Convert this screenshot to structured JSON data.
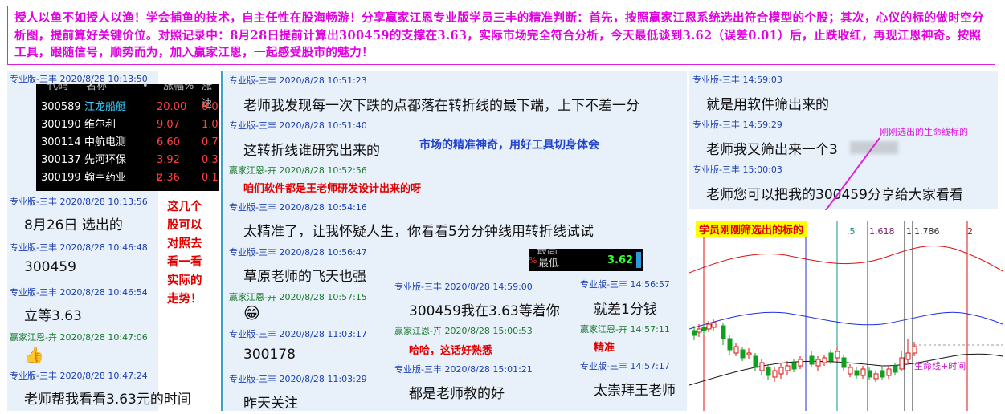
{
  "banner": {
    "text": "授人以鱼不如授人以渔！学会捕鱼的技术，自主任性在股海畅游！分享赢家江恩专业版学员三丰的精准判断：首先，按照赢家江恩系统选出符合模型的个股；其次，心仪的标的做时空分析图，提前算好关键价位。对照记录中：8月28日提前计算出300459的支撑在3.63，实际市场完全符合分析，今天最低谈到3.62（误差0.01）后，止跌收红，再现江恩神奇。按照工具，跟随信号，顺势而为，加入赢家江恩，一起感受股市的魅力！"
  },
  "stock_table": {
    "headers": [
      "代码",
      "名称",
      "•",
      "涨幅%",
      "涨速"
    ],
    "rows": [
      {
        "code": "300589",
        "name": "江龙船艇",
        "change": "20.00",
        "speed": "0.0",
        "name_color": "#3ad0ff"
      },
      {
        "code": "300190",
        "name": "维尔利",
        "change": "9.07",
        "speed": "1.0",
        "name_color": "#ffffff"
      },
      {
        "code": "300114",
        "name": "中航电测",
        "change": "6.60",
        "speed": "0.7",
        "name_color": "#ffffff"
      },
      {
        "code": "300137",
        "name": "先河环保",
        "change": "3.92",
        "speed": "0.3",
        "name_color": "#ffffff"
      },
      {
        "code": "300199",
        "name": "翰宇药业",
        "change": "2.36",
        "speed": "0.1",
        "name_color": "#ffffff",
        "flag": "R"
      }
    ]
  },
  "col1": {
    "h1": "专业版-三丰 2020/8/28 10:13:50",
    "h2": "专业版-三丰 2020/8/28 10:13:56",
    "m2": "8月26日 选出的",
    "h3": "专业版-三丰 2020/8/28 10:46:48",
    "m3": "300459",
    "h4": "专业版-三丰 2020/8/28 10:46:54",
    "m4": "立等3.63",
    "h5": "赢家江恩-卉 2020/8/28 10:47:06",
    "m5": "👍",
    "h6": "专业版-三丰 2020/8/28 10:47:24",
    "m6": "老师帮我看看3.63元的时间"
  },
  "note_left": [
    "这几个",
    "股可以",
    "对照去",
    "看一看",
    "实际的",
    "走势！"
  ],
  "col2": {
    "h1": "专业版-三丰 2020/8/28 10:51:23",
    "m1": "老师我发现每一次下跌的点都落在转折线的最下端，上下不差一分",
    "h2": "专业版-三丰 2020/8/28 10:51:40",
    "m2": "这转折线谁研究出来的",
    "note_blue": "市场的精准神奇，用好工具切身体会",
    "h3": "赢家江恩-卉 2020/8/28 10:52:56",
    "m3": "咱们软件都是王老师研发设计出来的呀",
    "h4": "专业版-三丰 2020/8/28 10:54:16",
    "m4": "太精准了，让我怀疑人生，你看看5分分钟线用转折线试试",
    "h5": "专业版-三丰 2020/8/28 10:56:47",
    "m5": "草原老师的飞天也强",
    "h6": "赢家江恩-卉 2020/8/28 10:57:15",
    "m6": "😁",
    "h7": "专业版-三丰 2020/8/28 11:03:17",
    "m7": "300178",
    "h8": "专业版-三丰 2020/8/28 11:03:29",
    "m8": "昨天关注"
  },
  "mini_quote": {
    "label": "最低",
    "value": "3.62",
    "prev": "最高"
  },
  "col3": {
    "h1": "专业版-三丰 2020/8/28 14:59:00",
    "m1": "300459我在3.63等着你",
    "h2": "赢家江恩-卉 2020/8/28 15:00:53",
    "m2": "哈哈，这话好熟悉",
    "h3": "专业版-三丰 2020/8/28 15:01:21",
    "m3": "都是老师教的好"
  },
  "col4": {
    "h1": "专业版-三丰 14:56:57",
    "m1": "就差1分钱",
    "h2": "赢家江恩-卉 14:57:11",
    "m2": "精准",
    "h3": "专业版-三丰 14:57:17",
    "m3": "太崇拜王老师"
  },
  "col5": {
    "h1": "专业版-三丰 14:59:03",
    "m1": "就是用软件筛出来的",
    "h2": "专业版-三丰 14:59:29",
    "m2": "老师我又筛出来一个3",
    "h3": "专业版-三丰 15:00:03",
    "m3": "老师您可以把我的300459分享给大家看看",
    "annotation": "刚刚选出的生命线标的"
  },
  "chart_data": {
    "type": "line",
    "title_badge": "学员刚刚筛选出的标的",
    "fib_labels": [
      ".5",
      "1.618",
      "1",
      "1.786",
      "2"
    ],
    "legend": "生命线+时间",
    "colors": {
      "upper": "#e01010",
      "middle": "#1e2ee0",
      "lower": "#111111",
      "up_candle": "#e01010",
      "down_candle": "#10a020"
    }
  }
}
